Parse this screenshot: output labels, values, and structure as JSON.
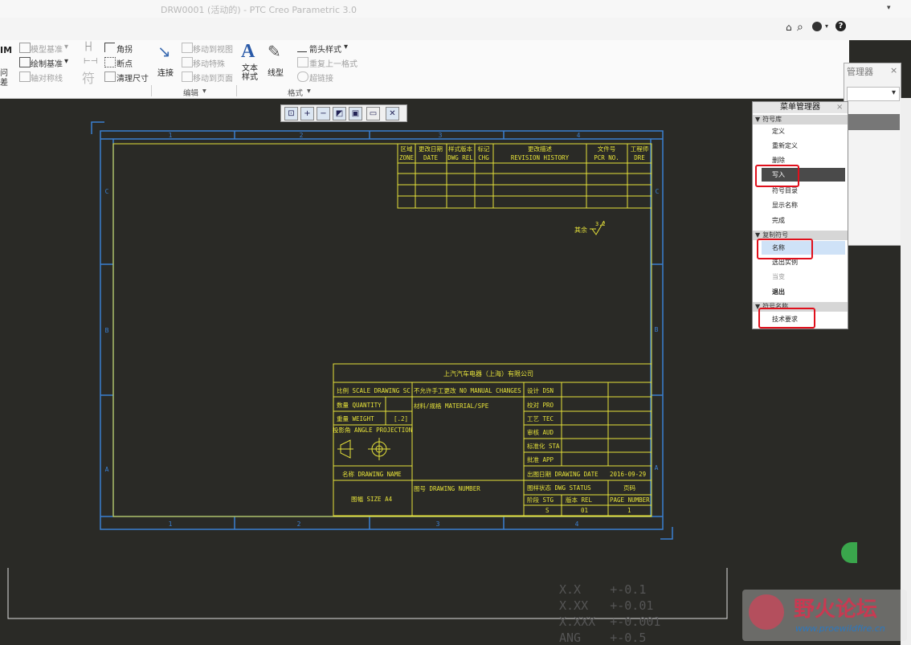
{
  "window": {
    "title": "DRW0001 (活动的) - PTC Creo Parametric 3.0"
  },
  "ribbon": {
    "col1": [
      "模型基准",
      "绘制基准",
      "轴对称线"
    ],
    "corner": "角拐",
    "breakpoint": "断点",
    "clean_dim": "清理尺寸",
    "connect": "连接",
    "move_to_view": "移动到视图",
    "move_special": "移动特殊",
    "move_to_page": "移动到页面",
    "text_style": "文本样式",
    "line_style": "线型",
    "arrow_style": "箭头样式",
    "repeat_format": "重复上一格式",
    "hyperlink": "超链接",
    "group_edit": "编辑",
    "group_format": "格式",
    "bg_panel_title": "管理器"
  },
  "drawing": {
    "col_numbers_top": [
      "1",
      "2",
      "3",
      "4"
    ],
    "col_numbers_bottom": [
      "1",
      "2",
      "3",
      "4"
    ],
    "row_letters": [
      "C",
      "B",
      "A"
    ],
    "revision_headers": [
      [
        "区域",
        "ZONE"
      ],
      [
        "更改日期",
        "DATE"
      ],
      [
        "样式版本",
        "DWG REL"
      ],
      [
        "标记",
        "CHG"
      ],
      [
        "更改描述",
        "REVISION HISTORY"
      ],
      [
        "文件号",
        "PCR NO."
      ],
      [
        "工程师",
        "DRE"
      ]
    ],
    "roughness_label": "其余",
    "roughness_value": "3.2",
    "title_block": {
      "company": "上汽汽车电器（上海）有限公司",
      "scale": "比例 SCALE DRAWING SC",
      "quantity": "数量 QUANTITY",
      "weight": "重量 WEIGHT",
      "weight_unit": "[.2]",
      "projection": "投影角 ANGLE PROJECTION",
      "name": "名称 DRAWING NAME",
      "size": "图幅 SIZE  A4",
      "no_manual_changes": "不允许手工更改 NO MANUAL CHANGES",
      "material": "材料/规格 MATERIAL/SPE",
      "drawing_number": "图号 DRAWING NUMBER",
      "approvals": [
        "设计  DSN",
        "校对  PRO",
        "工艺  TEC",
        "审核  AUD",
        "标准化 STA",
        "批准  APP"
      ],
      "date_label": "出图日期 DRAWING DATE",
      "date_value": "2016-09-29",
      "status_label": "图样状态  DWG STATUS",
      "page_label": "页码",
      "page_number_label": "PAGE NUMBER",
      "stage_label": "阶段  STG",
      "version_label": "版本  REL",
      "stage_value": "S",
      "version_value": "01",
      "page_value": "1"
    },
    "tolerances": [
      "X.X    +-0.1",
      "X.XX   +-0.01",
      "X.XXX  +-0.001",
      "ANG    +-0.5"
    ]
  },
  "menu_manager": {
    "title": "菜单管理器",
    "sections": [
      {
        "title": "符号库",
        "items": [
          "定义",
          "重新定义",
          "删除",
          "写入",
          "符号目录",
          "显示名称",
          "完成"
        ]
      },
      {
        "title": "复制符号",
        "items": [
          "名称",
          "选出实例",
          "当变",
          "退出"
        ]
      },
      {
        "title": "符号名称",
        "items": [
          "技术要求"
        ]
      }
    ]
  },
  "watermark": {
    "brand": "野火论坛",
    "url": "www.proewildfire.cn"
  },
  "colors": {
    "drawing_lines": "#e6e23a",
    "frame": "#3a7fd0",
    "background": "#2a2a26",
    "highlight": "#e0101c",
    "selected_item": "#4a4a4a"
  }
}
